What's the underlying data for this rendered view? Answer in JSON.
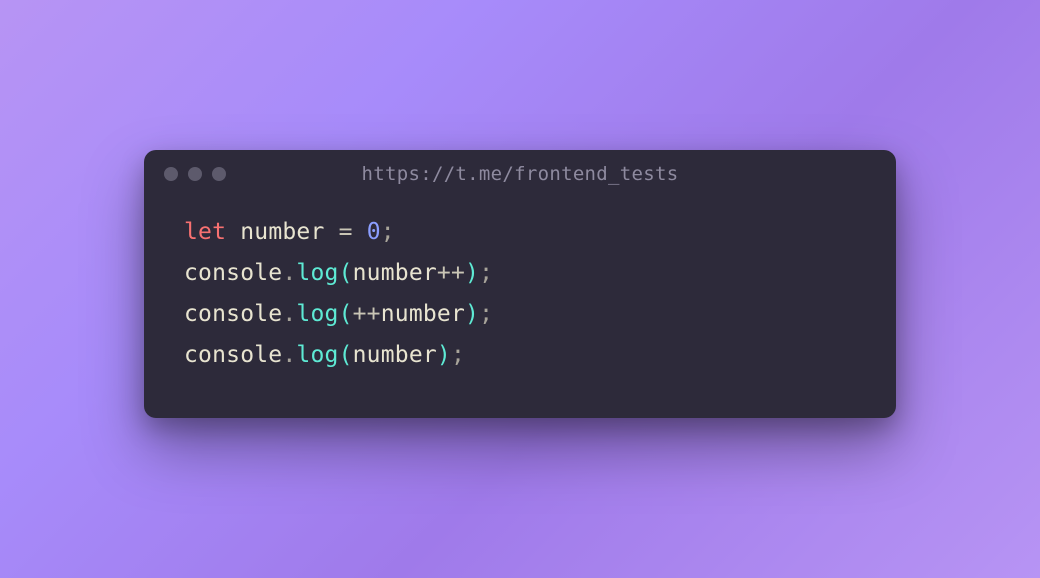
{
  "window": {
    "title": "https://t.me/frontend_tests"
  },
  "code": {
    "line1": {
      "keyword": "let",
      "space1": " ",
      "identifier": "number",
      "space2": " ",
      "equals": "=",
      "space3": " ",
      "value": "0",
      "semicolon": ";"
    },
    "line2": {
      "obj": "console",
      "dot": ".",
      "fn": "log",
      "open": "(",
      "var": "number",
      "op": "++",
      "close": ")",
      "semicolon": ";"
    },
    "line3": {
      "obj": "console",
      "dot": ".",
      "fn": "log",
      "open": "(",
      "op": "++",
      "var": "number",
      "close": ")",
      "semicolon": ";"
    },
    "line4": {
      "obj": "console",
      "dot": ".",
      "fn": "log",
      "open": "(",
      "var": "number",
      "close": ")",
      "semicolon": ";"
    }
  }
}
